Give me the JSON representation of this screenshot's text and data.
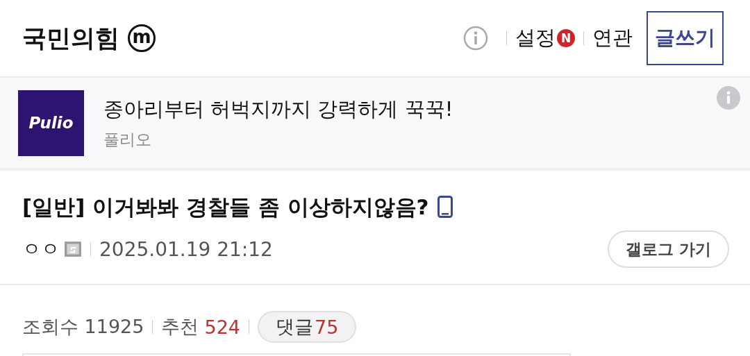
{
  "header": {
    "gallery_name": "국민의힘",
    "gallery_badge": "m",
    "settings": "설정",
    "settings_new_badge": "N",
    "related": "연관",
    "write_button": "글쓰기"
  },
  "ad": {
    "logo_text": "Pulio",
    "title": "종아리부터 허벅지까지 강력하게 꾹꾹!",
    "advertiser": "풀리오"
  },
  "post": {
    "category": "[일반]",
    "title": "이거봐봐 경찰들 좀 이상하지않음?",
    "author": "ㅇㅇ",
    "date": "2025.01.19 21:12",
    "gallery_button": "갤로그 가기"
  },
  "stats": {
    "views_label": "조회수",
    "views": "11925",
    "recommend_label": "추천",
    "recommend": "524",
    "comments_label": "댓글",
    "comments": "75"
  }
}
